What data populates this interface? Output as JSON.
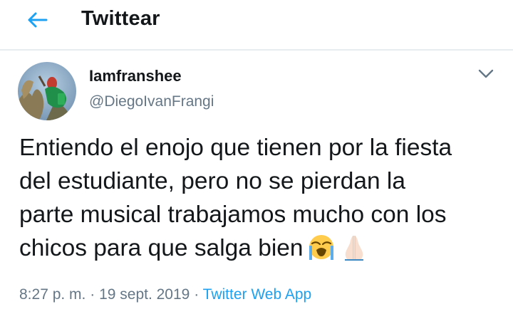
{
  "header": {
    "title": "Twittear"
  },
  "tweet": {
    "author_name": "Iamfranshee",
    "author_handle": "@DiegoIvanFrangi",
    "text_lines": [
      "Entiendo el enojo que tienen por la fiesta",
      "del estudiante, pero no se pierdan la",
      "parte musical trabajamos mucho con los",
      "chicos para que salga bien"
    ],
    "emojis": [
      "loudly-crying-face",
      "folded-hands"
    ],
    "time": "8:27 p. m.",
    "separator": "·",
    "date": "19 sept. 2019",
    "source": "Twitter Web App"
  },
  "icons": {
    "back": "arrow-left-icon",
    "more": "chevron-down-icon"
  },
  "colors": {
    "accent": "#1da1f2",
    "text": "#14171a",
    "secondary_text": "#657786",
    "divider": "#e6ecf0"
  }
}
